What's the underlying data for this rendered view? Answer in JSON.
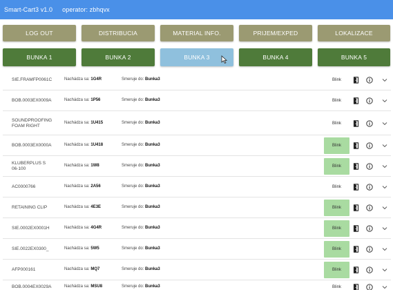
{
  "window": {
    "title": "Smart-Cart3 v1.0",
    "operator": "operator: zbhqvx"
  },
  "top_buttons": [
    "LOG OUT",
    "DISTRIBUCIA",
    "MATERIAL INFO.",
    "PRIJEM/EXPED",
    "LOKALIZACE"
  ],
  "cell_buttons": [
    "BUNKA 1",
    "BUNKA 2",
    "BUNKA 3",
    "BUNKA 4",
    "BUNKA 5"
  ],
  "active_cell": "BUNKA 3",
  "colors": {
    "titlebar": "#4a90e8",
    "top_button": "#9b9a72",
    "cell_button": "#4f7b3a",
    "cell_active": "#8fc0dd",
    "blink_on": "#a9dba1"
  },
  "icons": {
    "door": "exit-door-icon",
    "info": "info-circle-icon",
    "expand": "chevron-down-icon",
    "cursor": "mouse-pointer-icon"
  },
  "items": [
    {
      "code": "SIE.FRAMFP0061C",
      "loc_label": "Nachádza sa:",
      "loc": "1G4R",
      "dest_label": "Smeruje do:",
      "dest": "Bunka3",
      "blink": "Blink",
      "blink_on": false
    },
    {
      "code": "BOB.0003EX0009A",
      "loc_label": "Nachádza sa:",
      "loc": "1P56",
      "dest_label": "Smeruje do:",
      "dest": "Bunka3",
      "blink": "Blink",
      "blink_on": false
    },
    {
      "code": "SOUNDPROOFING FOAM RIGHT",
      "loc_label": "Nachádza sa:",
      "loc": "1U415",
      "dest_label": "Smeruje do:",
      "dest": "Bunka3",
      "blink": "Blink",
      "blink_on": false
    },
    {
      "code": "BOB.0003EX0000A",
      "loc_label": "Nachádza sa:",
      "loc": "1U418",
      "dest_label": "Smeruje do:",
      "dest": "Bunka3",
      "blink": "Blink",
      "blink_on": true
    },
    {
      "code": "KLUBERPLUS S 06-100",
      "loc_label": "Nachádza sa:",
      "loc": "1W8",
      "dest_label": "Smeruje do:",
      "dest": "Bunka3",
      "blink": "Blink",
      "blink_on": true
    },
    {
      "code": "AC0000766",
      "loc_label": "Nachádza sa:",
      "loc": "2A56",
      "dest_label": "Smeruje do:",
      "dest": "Bunka3",
      "blink": "Blink",
      "blink_on": false
    },
    {
      "code": "RETAINING CLIP",
      "loc_label": "Nachádza sa:",
      "loc": "4E3E",
      "dest_label": "Smeruje do:",
      "dest": "Bunka3",
      "blink": "Blink",
      "blink_on": true
    },
    {
      "code": "SIE.0002EX0001H",
      "loc_label": "Nachádza sa:",
      "loc": "4G4R",
      "dest_label": "Smeruje do:",
      "dest": "Bunka3",
      "blink": "Blink",
      "blink_on": true
    },
    {
      "code": "SIE.0022EX0300_",
      "loc_label": "Nachádza sa:",
      "loc": "5W5",
      "dest_label": "Smeruje do:",
      "dest": "Bunka3",
      "blink": "Blink",
      "blink_on": true
    },
    {
      "code": "AFP000161",
      "loc_label": "Nachádza sa:",
      "loc": "MQ7",
      "dest_label": "Smeruje do:",
      "dest": "Bunka3",
      "blink": "Blink",
      "blink_on": true
    },
    {
      "code": "BOB.0004EX0029A",
      "loc_label": "Nachádza sa:",
      "loc": "MSU8",
      "dest_label": "Smeruje do:",
      "dest": "Bunka3",
      "blink": "Blink",
      "blink_on": false
    }
  ]
}
